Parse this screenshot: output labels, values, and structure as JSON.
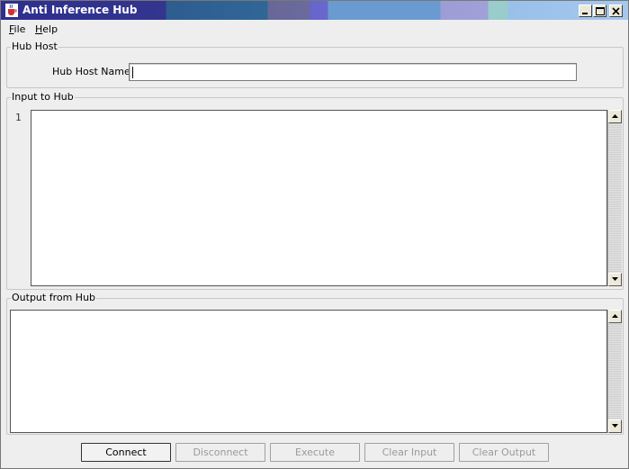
{
  "window": {
    "title": "Anti Inference Hub"
  },
  "menu": {
    "file": {
      "mnemonic": "F",
      "rest": "ile"
    },
    "help": {
      "mnemonic": "H",
      "rest": "elp"
    }
  },
  "hub_host": {
    "group_title": "Hub Host",
    "label": "Hub Host Name:",
    "value": ""
  },
  "input": {
    "group_title": "Input to Hub",
    "line_number": "1",
    "value": ""
  },
  "output": {
    "group_title": "Output from Hub",
    "value": ""
  },
  "buttons": {
    "connect": {
      "label": "Connect",
      "enabled": true
    },
    "disconnect": {
      "label": "Disconnect",
      "enabled": false
    },
    "execute": {
      "label": "Execute",
      "enabled": false
    },
    "clear_input": {
      "label": "Clear Input",
      "enabled": false
    },
    "clear_output": {
      "label": "Clear Output",
      "enabled": false
    }
  },
  "icons": {
    "app": "java-cup-icon",
    "minimize": "minimize-icon",
    "maximize": "maximize-icon",
    "close": "close-icon",
    "scroll_up": "arrow-up-icon",
    "scroll_down": "arrow-down-icon"
  }
}
